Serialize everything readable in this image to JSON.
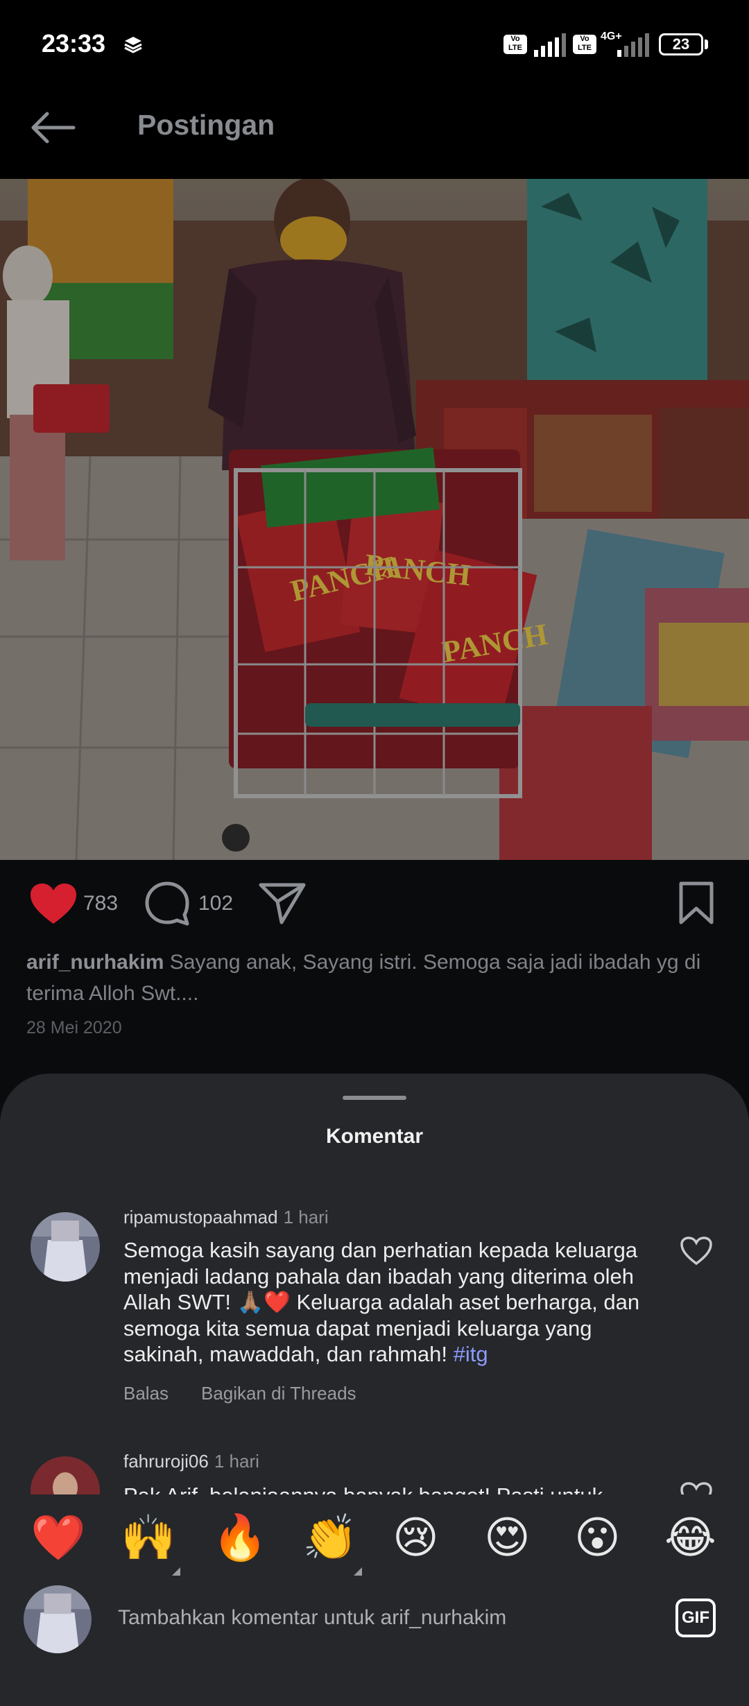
{
  "status_bar": {
    "time": "23:33",
    "battery": "23",
    "network": "4G+",
    "volte": "Vo LTE",
    "icons": [
      "layers-icon",
      "signal-icon",
      "battery-icon"
    ]
  },
  "app_bar": {
    "title": "Postingan",
    "back_icon": "arrow-left-icon"
  },
  "post": {
    "likes": "783",
    "comments": "102",
    "username": "arif_nurhakim",
    "caption": "Sayang anak, Sayang istri. Semoga saja jadi ibadah yg di terima Alloh Swt....",
    "date": "28 Mei 2020",
    "liked": true,
    "like_color": "#d6202f"
  },
  "comments_sheet": {
    "title": "Komentar",
    "comments": [
      {
        "username": "ripamustopaahmad",
        "time": "1 hari",
        "lines": [
          "Semoga kasih sayang dan perhatian kepada keluarga",
          "menjadi ladang pahala dan ibadah yang diterima oleh",
          "Allah SWT! 🙏🏽❤️ Keluarga adalah aset berharga, dan",
          "semoga kita semua dapat menjadi keluarga yang",
          "sakinah, mawaddah, dan rahmah!"
        ],
        "hashtag": "#itg",
        "reply_label": "Balas",
        "share_label": "Bagikan di Threads"
      },
      {
        "username": "fahruroji06",
        "time": "1 hari",
        "lines": [
          "Pak Arif, belanjaannya banyak banget! Pasti untuk"
        ]
      }
    ]
  },
  "reactions": [
    "❤️",
    "🙌",
    "🔥",
    "👏",
    "😢",
    "😍",
    "😮",
    "😂"
  ],
  "comment_input": {
    "placeholder": "Tambahkan komentar untuk arif_nurhakim",
    "gif_label": "GIF"
  },
  "colors": {
    "accent_hashtag": "#8b9bff",
    "sheet_bg": "#25272b",
    "page_bg": "#0a0b0d"
  }
}
